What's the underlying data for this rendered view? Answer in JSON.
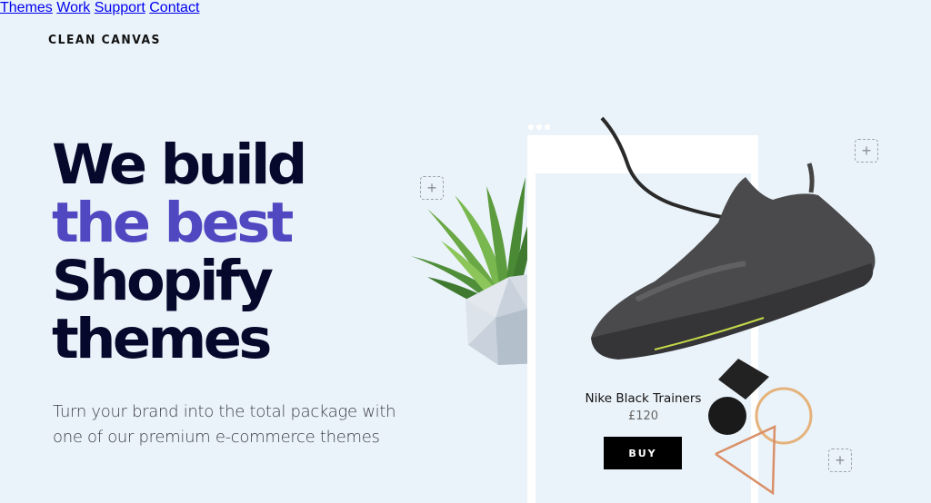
{
  "brand": {
    "logo": "CLEAN CANVAS"
  },
  "nav": {
    "items": [
      {
        "label": "Themes"
      },
      {
        "label": "Work"
      },
      {
        "label": "Support"
      },
      {
        "label": "Contact"
      }
    ]
  },
  "hero": {
    "headline_lines": [
      "We build",
      "the best",
      "Shopify",
      "themes"
    ],
    "subheadline_line1": "Turn your brand into the total package with",
    "subheadline_line2": "one of our premium e-commerce themes",
    "accent_color": "#5048c1"
  },
  "product_card": {
    "name": "Nike Black Trainers",
    "price": "£120",
    "buy_label": "BUY"
  },
  "decorations": {
    "add_icon_glyph": "+"
  }
}
